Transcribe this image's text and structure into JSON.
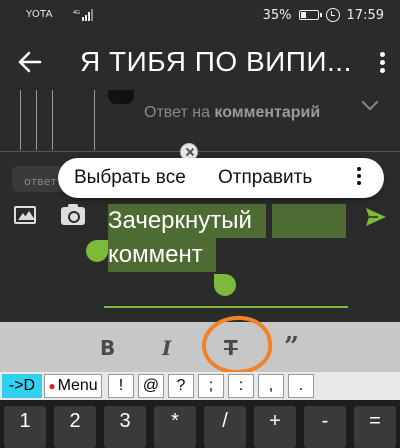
{
  "status_bar": {
    "carrier": "YOTA",
    "network": "4G",
    "battery": "35%",
    "time": "17:59"
  },
  "app_bar": {
    "title": "Я ТИБЯ ПО ВИПИ..."
  },
  "feed": {
    "reply_prefix": "Ответ на",
    "reply_target": "комментарий"
  },
  "composer": {
    "previous_reply": "ответ",
    "text_line1": "Зачеркнутый",
    "text_line2": "коммент"
  },
  "context_menu": {
    "select_all": "Выбрать все",
    "send": "Отправить"
  },
  "format_toolbar": {
    "bold": "B",
    "italic": "I",
    "strikethrough": "T",
    "quote": "”"
  },
  "symbol_row": {
    "keys": [
      "->D",
      "Menu",
      "!",
      "@",
      "?",
      ";",
      ":",
      ",",
      "."
    ]
  },
  "number_row": {
    "keys": [
      "1",
      "2",
      "3",
      "*",
      "/",
      "+",
      "-",
      "="
    ]
  },
  "colors": {
    "accent": "#7dba3a",
    "selection": "#4e6b33",
    "annotation": "#f0822a",
    "key_highlight": "#2fd0f0"
  }
}
